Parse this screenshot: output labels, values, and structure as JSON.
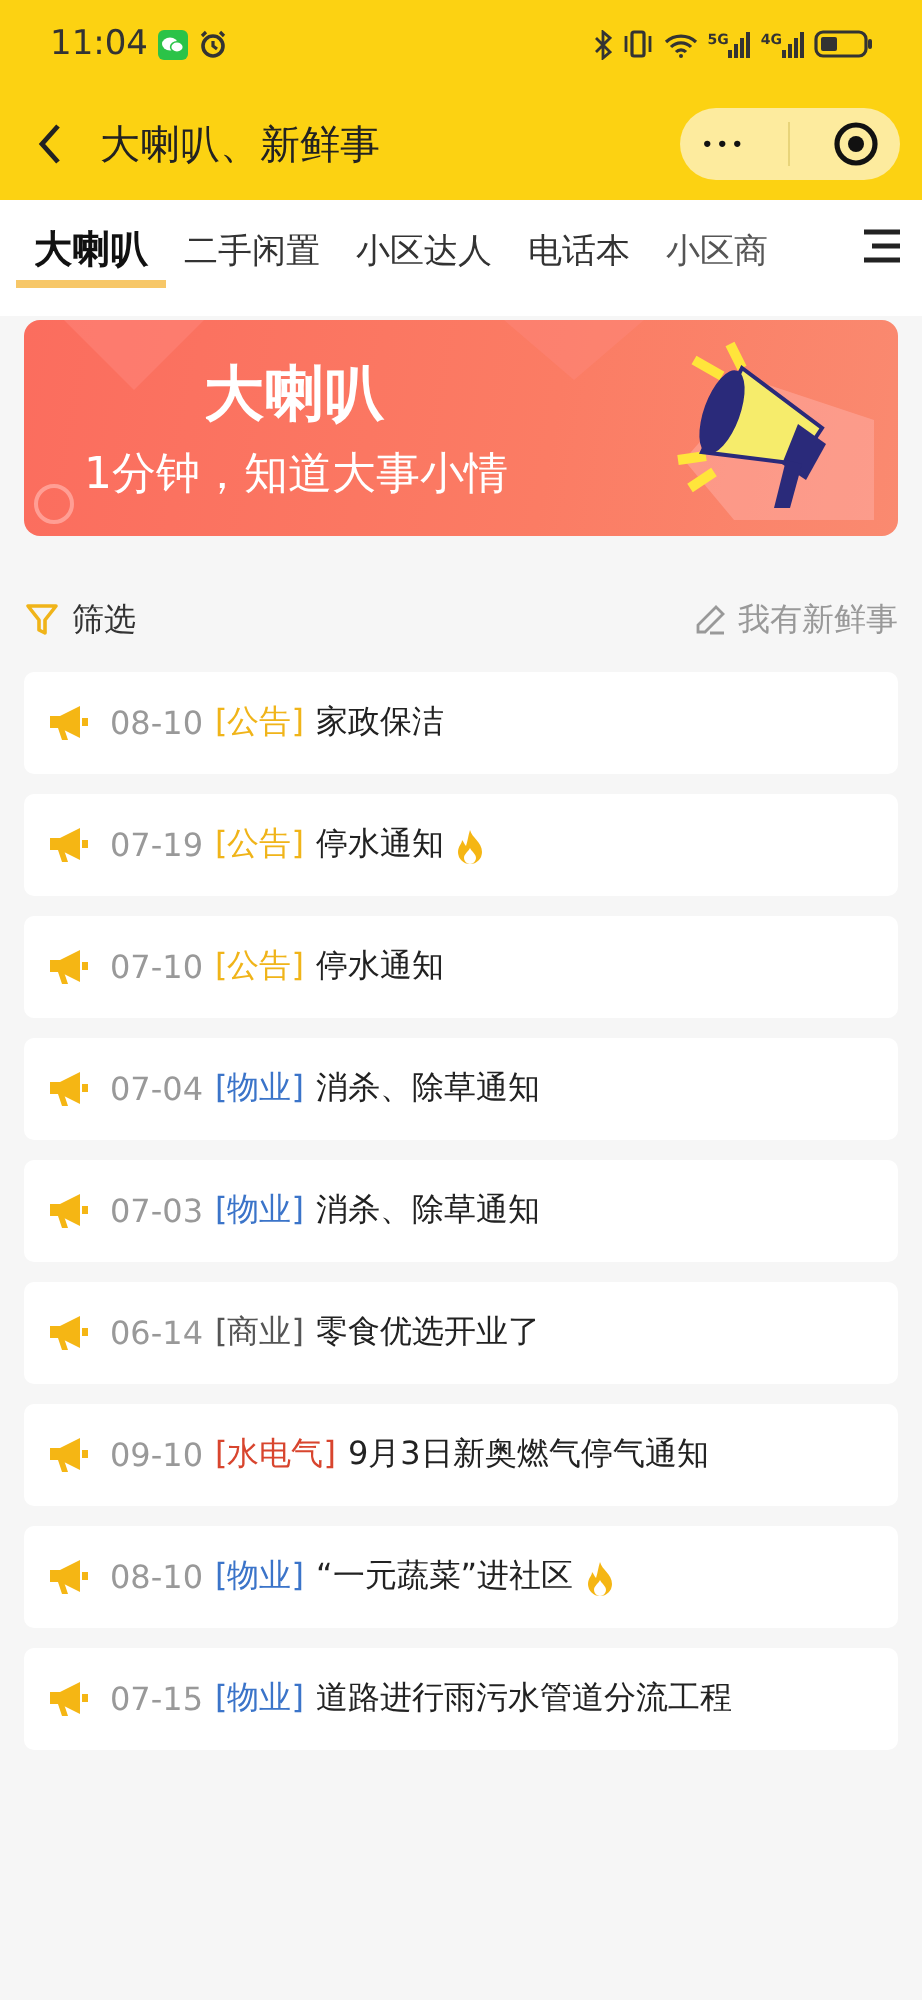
{
  "status_bar": {
    "time": "11:04",
    "network_1": "5G",
    "network_2": "4G"
  },
  "nav": {
    "title": "大喇叭、新鲜事",
    "more_button": "•••"
  },
  "tabs": [
    {
      "label": "大喇叭",
      "selected": true
    },
    {
      "label": "二手闲置",
      "selected": false
    },
    {
      "label": "小区达人",
      "selected": false
    },
    {
      "label": "电话本",
      "selected": false
    },
    {
      "label": "小区商",
      "selected": false
    }
  ],
  "banner": {
    "title": "大喇叭",
    "subtitle": "1分钟，知道大事小情"
  },
  "toolbar": {
    "filter": "筛选",
    "post": "我有新鲜事"
  },
  "posts": [
    {
      "date": "08-10",
      "tag": "[公告]",
      "color": "#f0b419",
      "title": "家政保洁",
      "hot": false
    },
    {
      "date": "07-19",
      "tag": "[公告]",
      "color": "#f0b419",
      "title": "停水通知",
      "hot": true
    },
    {
      "date": "07-10",
      "tag": "[公告]",
      "color": "#f0b419",
      "title": "停水通知",
      "hot": false
    },
    {
      "date": "07-04",
      "tag": "[物业]",
      "color": "#3b74c9",
      "title": "消杀、除草通知",
      "hot": false
    },
    {
      "date": "07-03",
      "tag": "[物业]",
      "color": "#3b74c9",
      "title": "消杀、除草通知",
      "hot": false
    },
    {
      "date": "06-14",
      "tag": "[商业]",
      "color": "#555555",
      "title": "零食优选开业了",
      "hot": false
    },
    {
      "date": "09-10",
      "tag": "[水电气]",
      "color": "#d8452e",
      "title": "9月3日新奥燃气停气通知",
      "hot": false
    },
    {
      "date": "08-10",
      "tag": "[物业]",
      "color": "#3b74c9",
      "title": "“一元蔬菜”进社区",
      "hot": true
    },
    {
      "date": "07-15",
      "tag": "[物业]",
      "color": "#3b74c9",
      "title": "道路进行雨污水管道分流工程",
      "hot": false
    }
  ]
}
